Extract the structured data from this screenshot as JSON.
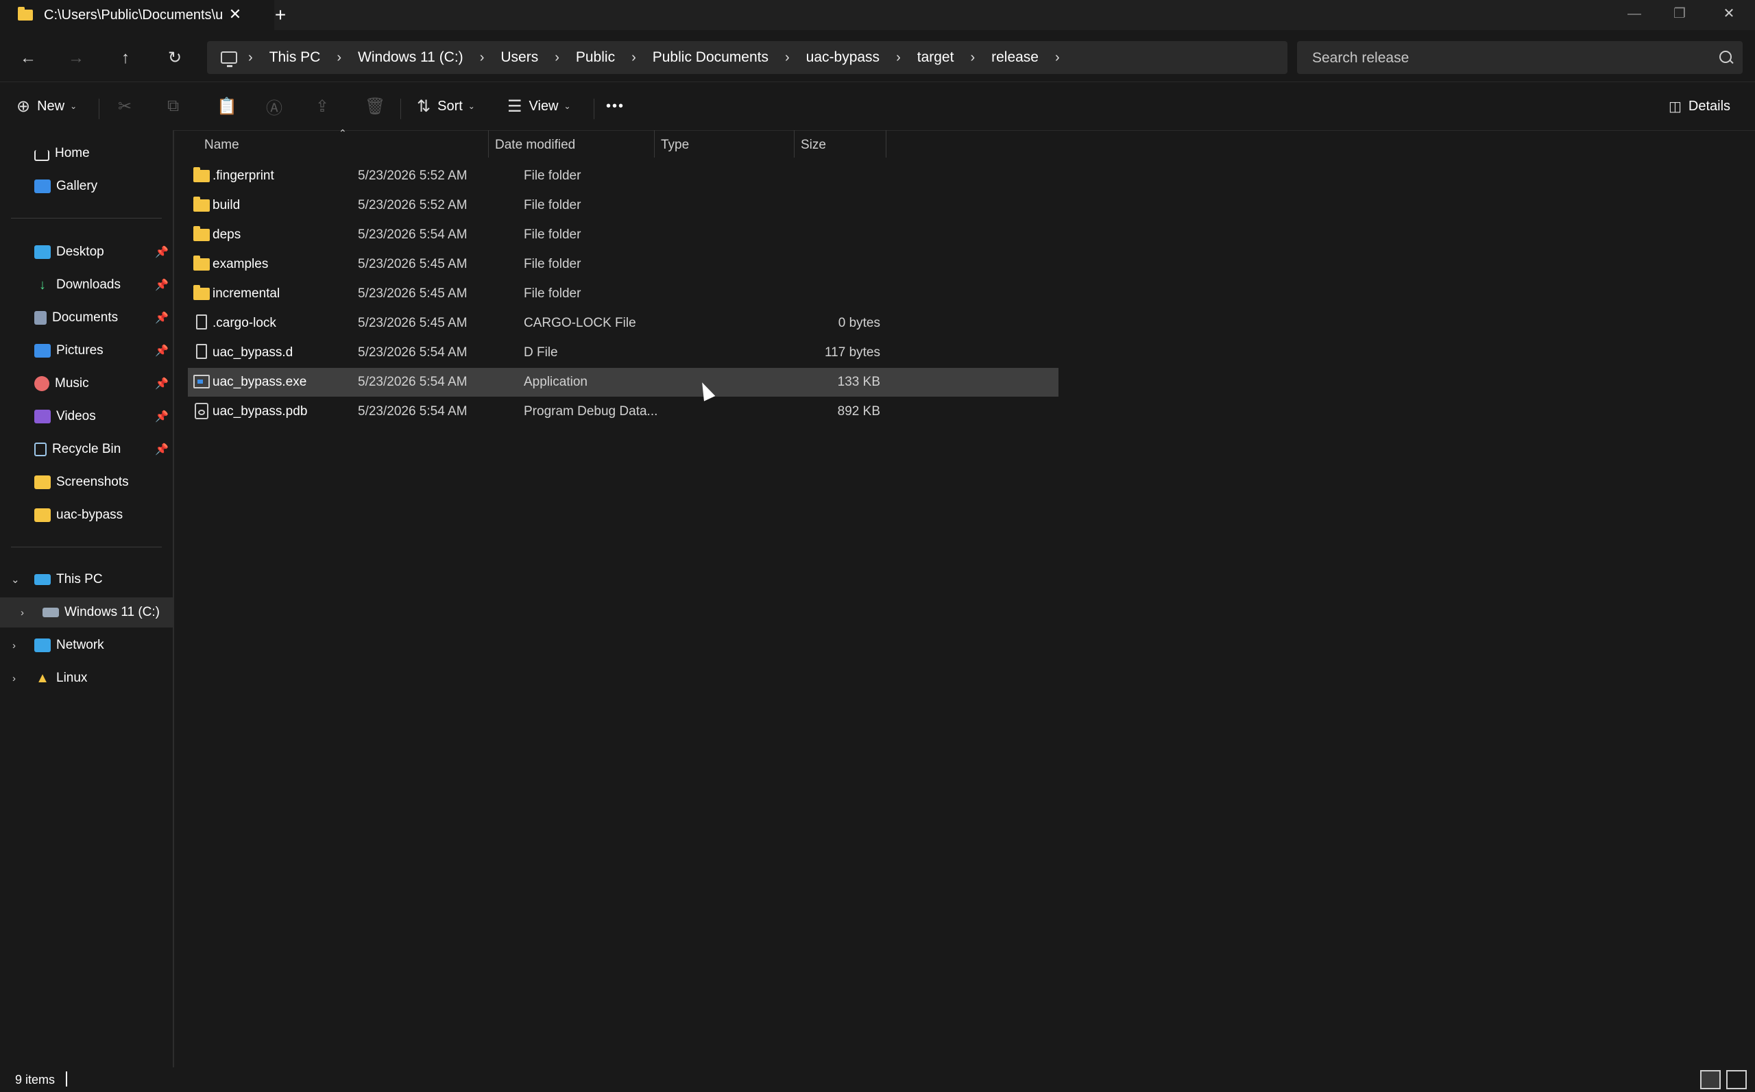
{
  "window": {
    "tab_title": "C:\\Users\\Public\\Documents\\u",
    "tab_close": "✕",
    "new_tab": "+",
    "minimize": "—",
    "maximize": "❐",
    "close": "✕"
  },
  "nav": {
    "back": "←",
    "forward": "→",
    "up": "↑",
    "refresh": "↻",
    "breadcrumb": [
      "This PC",
      "Windows 11 (C:)",
      "Users",
      "Public",
      "Public Documents",
      "uac-bypass",
      "target",
      "release"
    ],
    "search_placeholder": "Search release"
  },
  "commandbar": {
    "new_label": "New",
    "sort_label": "Sort",
    "view_label": "View",
    "more": "•••",
    "details_label": "Details"
  },
  "sidebar": {
    "home": "Home",
    "gallery": "Gallery",
    "pinned": [
      "Desktop",
      "Downloads",
      "Documents",
      "Pictures",
      "Music",
      "Videos",
      "Recycle Bin"
    ],
    "folders": [
      "Screenshots",
      "uac-bypass"
    ],
    "this_pc": "This PC",
    "drive": "Windows 11 (C:)",
    "network": "Network",
    "linux": "Linux"
  },
  "columns": {
    "name": "Name",
    "date": "Date modified",
    "type": "Type",
    "size": "Size"
  },
  "files": [
    {
      "name": ".fingerprint",
      "date": "5/23/2026 5:52 AM",
      "type": "File folder",
      "size": "",
      "icon": "folder-icon"
    },
    {
      "name": "build",
      "date": "5/23/2026 5:52 AM",
      "type": "File folder",
      "size": "",
      "icon": "folder-icon"
    },
    {
      "name": "deps",
      "date": "5/23/2026 5:54 AM",
      "type": "File folder",
      "size": "",
      "icon": "folder-icon"
    },
    {
      "name": "examples",
      "date": "5/23/2026 5:45 AM",
      "type": "File folder",
      "size": "",
      "icon": "folder-icon"
    },
    {
      "name": "incremental",
      "date": "5/23/2026 5:45 AM",
      "type": "File folder",
      "size": "",
      "icon": "folder-icon"
    },
    {
      "name": ".cargo-lock",
      "date": "5/23/2026 5:45 AM",
      "type": "CARGO-LOCK File",
      "size": "0 bytes",
      "icon": "file-icon"
    },
    {
      "name": "uac_bypass.d",
      "date": "5/23/2026 5:54 AM",
      "type": "D File",
      "size": "117 bytes",
      "icon": "file-icon"
    },
    {
      "name": "uac_bypass.exe",
      "date": "5/23/2026 5:54 AM",
      "type": "Application",
      "size": "133 KB",
      "icon": "application-icon"
    },
    {
      "name": "uac_bypass.pdb",
      "date": "5/23/2026 5:54 AM",
      "type": "Program Debug Data...",
      "size": "892 KB",
      "icon": "debug-file-icon"
    }
  ],
  "selected_file": "uac_bypass.exe",
  "status": {
    "item_count": "9 items"
  },
  "colors": {
    "background": "#191919",
    "selected_row": "#3f3f3f",
    "folder": "#f5c542",
    "accent": "#3b8ee8"
  }
}
